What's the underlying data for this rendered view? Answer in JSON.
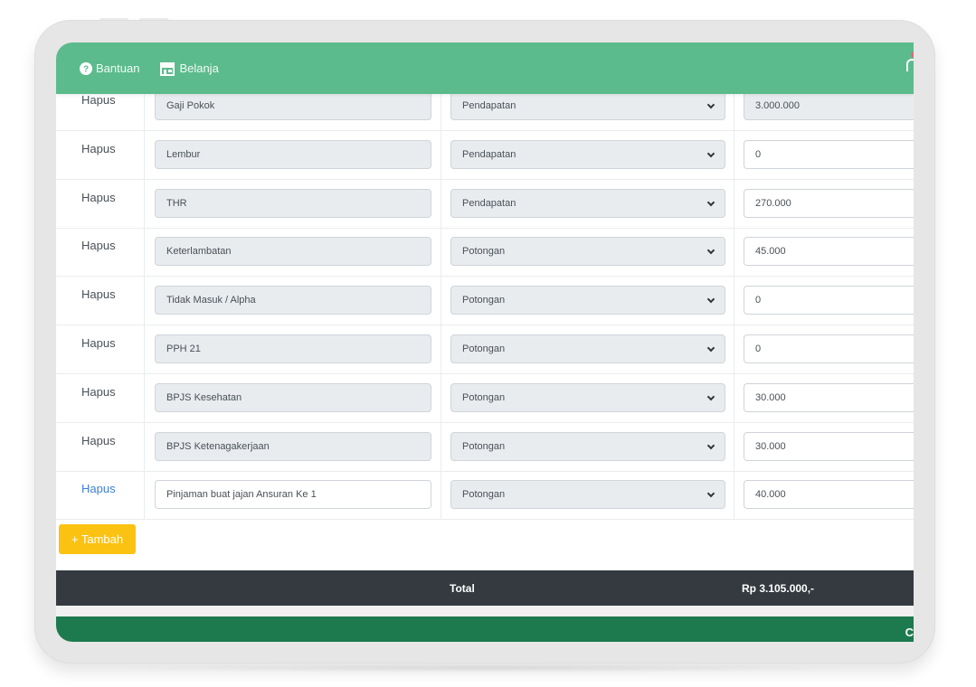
{
  "header": {
    "nav": [
      {
        "label": "Bantuan",
        "icon": "question-circle-icon"
      },
      {
        "label": "Belanja",
        "icon": "store-icon"
      }
    ]
  },
  "rows": [
    {
      "action": "Hapus",
      "name": "Gaji Pokok",
      "type": "Pendapatan",
      "amount": "3.000.000",
      "amount_editable": false,
      "action_active": false
    },
    {
      "action": "Hapus",
      "name": "Lembur",
      "type": "Pendapatan",
      "amount": "0",
      "amount_editable": true,
      "action_active": false
    },
    {
      "action": "Hapus",
      "name": "THR",
      "type": "Pendapatan",
      "amount": "270.000",
      "amount_editable": true,
      "action_active": false
    },
    {
      "action": "Hapus",
      "name": "Keterlambatan",
      "type": "Potongan",
      "amount": "45.000",
      "amount_editable": true,
      "action_active": false
    },
    {
      "action": "Hapus",
      "name": "Tidak Masuk / Alpha",
      "type": "Potongan",
      "amount": "0",
      "amount_editable": true,
      "action_active": false
    },
    {
      "action": "Hapus",
      "name": "PPH 21",
      "type": "Potongan",
      "amount": "0",
      "amount_editable": true,
      "action_active": false
    },
    {
      "action": "Hapus",
      "name": "BPJS Kesehatan",
      "type": "Potongan",
      "amount": "30.000",
      "amount_editable": true,
      "action_active": false
    },
    {
      "action": "Hapus",
      "name": "BPJS Ketenagakerjaan",
      "type": "Potongan",
      "amount": "30.000",
      "amount_editable": true,
      "action_active": false
    },
    {
      "action": "Hapus",
      "name": "Pinjaman buat jajan Ansuran Ke 1",
      "type": "Potongan",
      "amount": "40.000",
      "amount_editable": true,
      "action_active": true
    }
  ],
  "add_button": {
    "label": "+ Tambah"
  },
  "total": {
    "label": "Total",
    "value": "Rp 3.105.000,-"
  },
  "footer": {
    "text": "C"
  },
  "colors": {
    "header_green": "#5cbb8c",
    "footer_green": "#1c7a4e",
    "total_bar": "#343a40",
    "add_button": "#fbc212",
    "link_blue": "#3d7fd6"
  }
}
